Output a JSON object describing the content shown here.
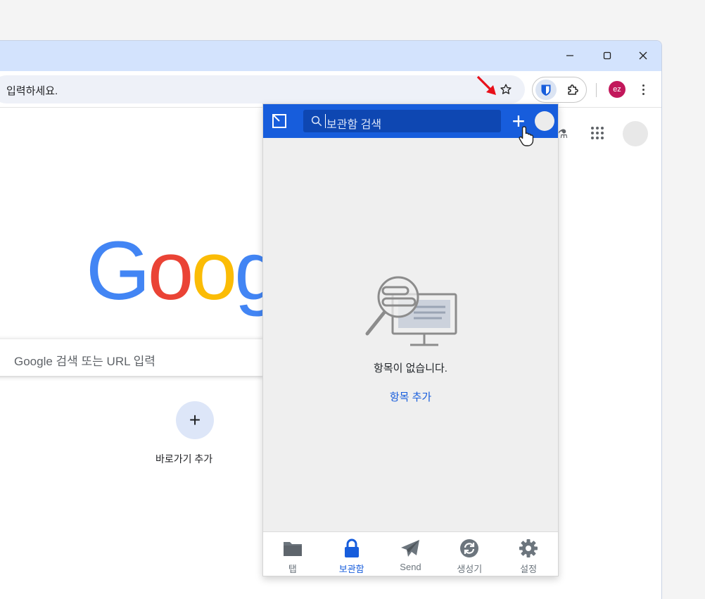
{
  "window": {
    "minimize_icon": "minimize-icon",
    "maximize_icon": "maximize-icon",
    "close_icon": "close-icon"
  },
  "toolbar": {
    "address_text": "입력하세요.",
    "avatar_initials": "ez",
    "avatar_color": "#c2185b"
  },
  "newtab": {
    "logo_text": "Googl",
    "search_placeholder": "Google 검색 또는 URL 입력",
    "shortcut_add_symbol": "+",
    "shortcut_add_label": "바로가기 추가"
  },
  "popup": {
    "search_placeholder": "보관함 검색",
    "add_symbol": "+",
    "empty_message": "항목이 없습니다.",
    "add_item_link": "항목 추가",
    "tabs": [
      {
        "label": "탭",
        "icon": "folder-icon",
        "active": false
      },
      {
        "label": "보관함",
        "icon": "lock-icon",
        "active": true
      },
      {
        "label": "Send",
        "icon": "paper-plane-icon",
        "active": false
      },
      {
        "label": "생성기",
        "icon": "refresh-icon",
        "active": false
      },
      {
        "label": "설정",
        "icon": "gear-icon",
        "active": false
      }
    ],
    "accent_color": "#175ddc"
  },
  "colors": {
    "titlebar": "#d3e3fd",
    "google_blue": "#4285f4",
    "google_red": "#ea4335",
    "google_yellow": "#fbbc05",
    "google_green": "#34a853"
  }
}
